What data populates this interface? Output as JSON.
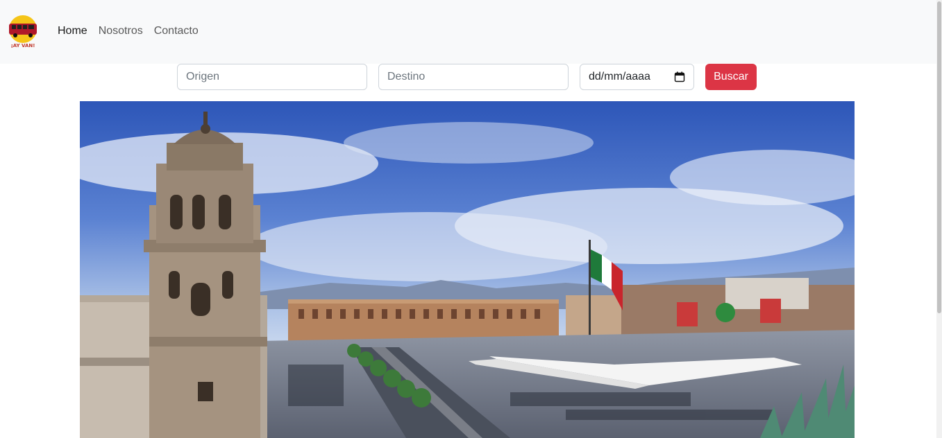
{
  "brand": {
    "logo_text": "¡AY VAN!"
  },
  "nav": {
    "items": [
      {
        "label": "Home",
        "active": true
      },
      {
        "label": "Nosotros"
      },
      {
        "label": "Contacto"
      }
    ]
  },
  "search": {
    "origin_placeholder": "Origen",
    "destination_placeholder": "Destino",
    "date_placeholder": "dd/mm/aaaa",
    "button_label": "Buscar"
  },
  "colors": {
    "accent": "#dc3545",
    "navbar_bg": "#f8f9fa"
  },
  "hero": {
    "subject": "Zócalo of Mexico City with Metropolitan Cathedral and Mexican flag"
  }
}
